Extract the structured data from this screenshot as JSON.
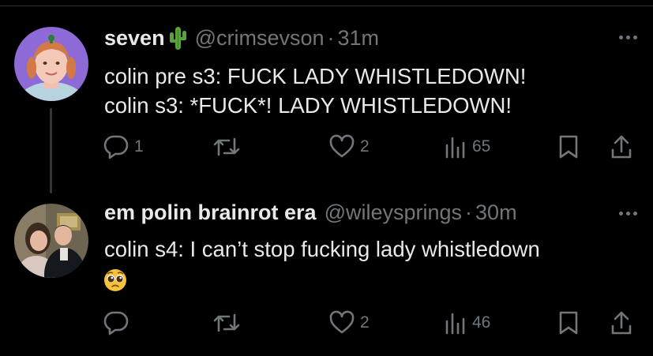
{
  "tweets": [
    {
      "name": "seven",
      "name_emoji": "cactus",
      "handle": "@crimsevson",
      "separator": "·",
      "time": "31m",
      "lines": [
        "colin pre s3: FUCK LADY WHISTLEDOWN!",
        "colin s3: *FUCK*! LADY WHISTLEDOWN!"
      ],
      "replies": "1",
      "reposts": "",
      "likes": "2",
      "views": "65"
    },
    {
      "name": "em polin brainrot era",
      "handle": "@wileysprings",
      "separator": "·",
      "time": "30m",
      "lines": [
        "colin s4: I can’t stop fucking lady whistledown"
      ],
      "emoji": "pleading-face",
      "replies": "",
      "reposts": "",
      "likes": "2",
      "views": "46"
    }
  ],
  "colors": {
    "background": "#000000",
    "text": "#e7e9ea",
    "muted": "#71767b",
    "thread_line": "#333639",
    "avatar1_bg": "#8e6ad6"
  }
}
